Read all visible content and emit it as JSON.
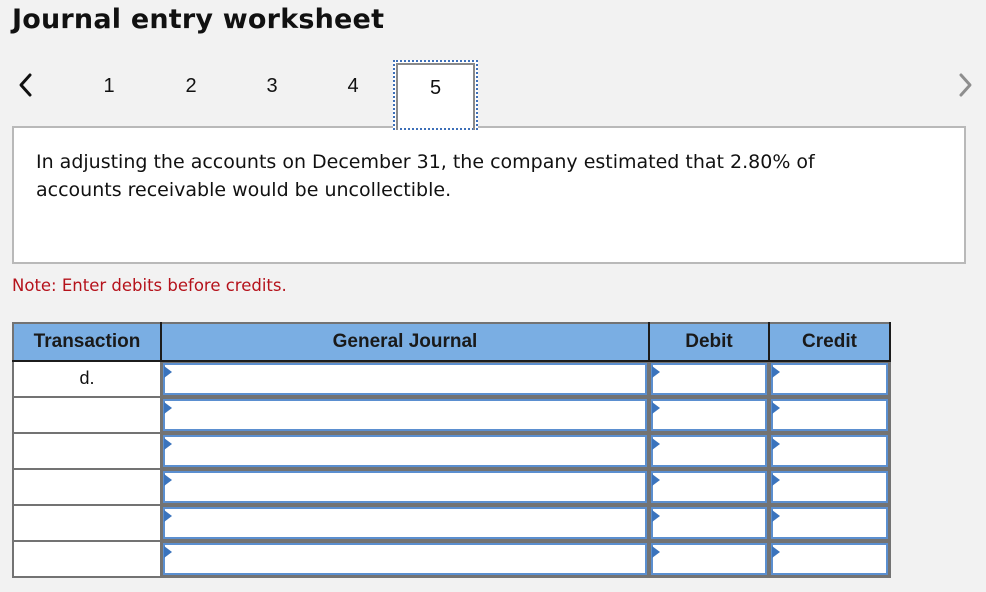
{
  "header": {
    "title": "Journal entry worksheet"
  },
  "navigation": {
    "prev_icon": "chevron-left-icon",
    "next_icon": "chevron-right-icon",
    "prev_enabled": true,
    "next_enabled": false,
    "tabs": [
      {
        "label": "1",
        "active": false
      },
      {
        "label": "2",
        "active": false
      },
      {
        "label": "3",
        "active": false
      },
      {
        "label": "4",
        "active": false
      },
      {
        "label": "5",
        "active": true
      }
    ]
  },
  "prompt": {
    "text": "In adjusting the accounts on December 31, the company estimated that 2.80% of accounts receivable would be uncollectible."
  },
  "note": {
    "text": "Note: Enter debits before credits.",
    "color": "#b5121b"
  },
  "journal": {
    "header_color": "#7aaee3",
    "columns": [
      "Transaction",
      "General Journal",
      "Debit",
      "Credit"
    ],
    "rows": [
      {
        "transaction": "d.",
        "account": "",
        "debit": "",
        "credit": ""
      },
      {
        "transaction": "",
        "account": "",
        "debit": "",
        "credit": ""
      },
      {
        "transaction": "",
        "account": "",
        "debit": "",
        "credit": ""
      },
      {
        "transaction": "",
        "account": "",
        "debit": "",
        "credit": ""
      },
      {
        "transaction": "",
        "account": "",
        "debit": "",
        "credit": ""
      },
      {
        "transaction": "",
        "account": "",
        "debit": "",
        "credit": ""
      }
    ]
  }
}
